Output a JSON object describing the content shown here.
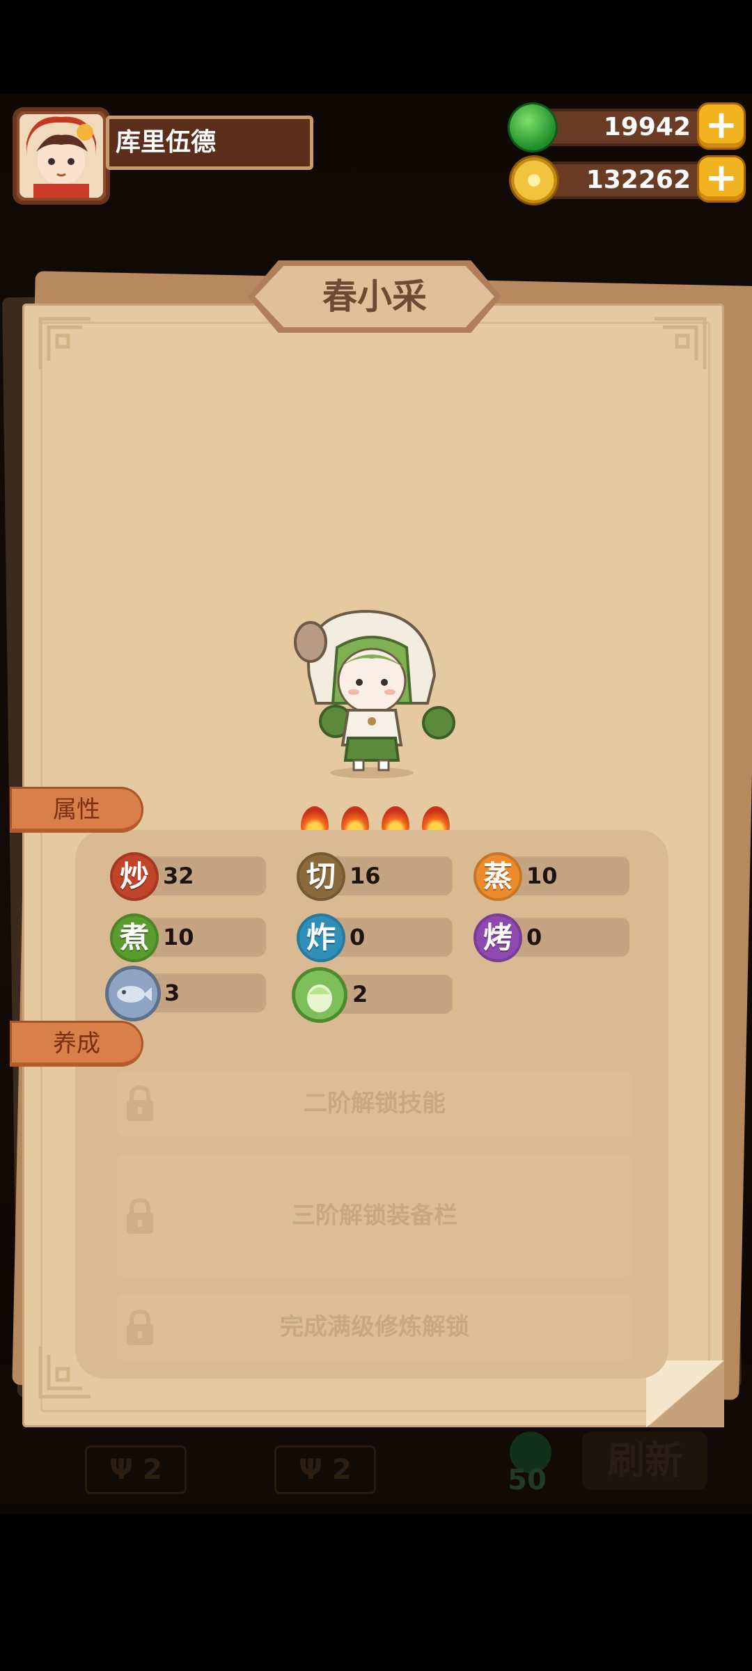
{
  "player": {
    "name": "库里伍德"
  },
  "currency": {
    "jade": {
      "value": "19942",
      "icon": "jade-coin-icon"
    },
    "gold": {
      "value": "132262",
      "icon": "gold-coin-icon"
    }
  },
  "character": {
    "name": "春小采",
    "stars": 4
  },
  "tabs": {
    "attributes": "属性",
    "training": "养成"
  },
  "stats": [
    {
      "key": "炒",
      "value": "32",
      "color": "#c0432a"
    },
    {
      "key": "切",
      "value": "16",
      "color": "#8a6a3a"
    },
    {
      "key": "蒸",
      "value": "10",
      "color": "#ec8a2c"
    },
    {
      "key": "煮",
      "value": "10",
      "color": "#5a9c2e"
    },
    {
      "key": "炸",
      "value": "0",
      "color": "#2f8fb8"
    },
    {
      "key": "烤",
      "value": "0",
      "color": "#8e49b0"
    }
  ],
  "ingredients": [
    {
      "icon": "fish-icon",
      "value": "3"
    },
    {
      "icon": "cabbage-icon",
      "value": "2"
    }
  ],
  "locks": [
    "二阶解锁技能",
    "三阶解锁装备栏",
    "完成满级修炼解锁"
  ],
  "background": {
    "tag1": "2",
    "tag2": "2",
    "cost": "50",
    "refresh": "刷新"
  },
  "colors": {
    "accent": "#f1b320",
    "card": "#e5c9a1",
    "tab": "#d9804a"
  }
}
